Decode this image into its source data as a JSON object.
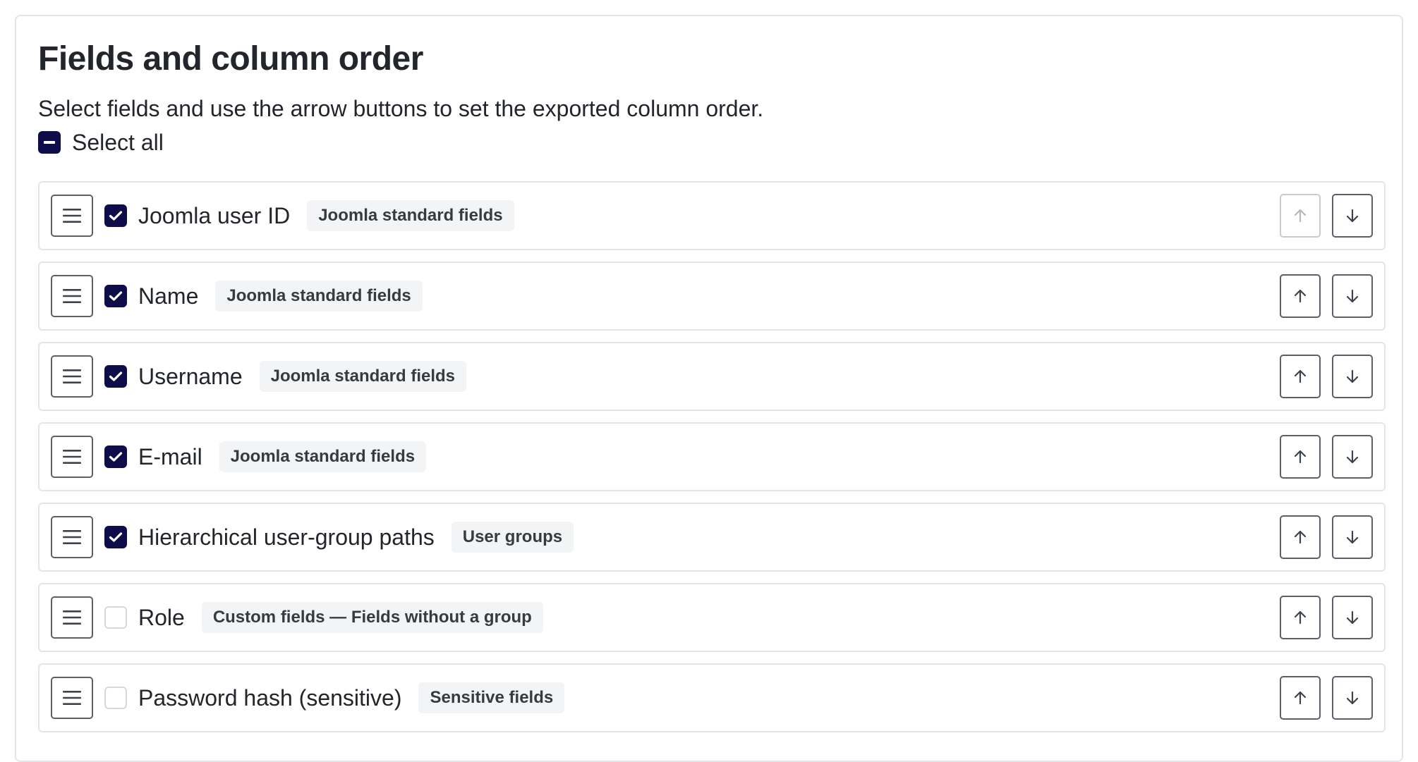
{
  "section": {
    "title": "Fields and column order",
    "description": "Select fields and use the arrow buttons to set the exported column order.",
    "select_all_label": "Select all",
    "select_all_state": "indeterminate"
  },
  "icons": {
    "drag": "drag-handle-icon",
    "check": "checkmark-icon",
    "indeterminate": "minus-icon",
    "up": "arrow-up-icon",
    "down": "arrow-down-icon"
  },
  "colors": {
    "checkbox_checked": "#0e0d4a",
    "checkbox_unchecked_border": "#d6d8dc",
    "badge_bg": "#f3f4f6",
    "row_border": "#e3e5e8",
    "button_border": "#5a6068",
    "button_disabled_border": "#c8ccd1"
  },
  "fields": [
    {
      "label": "Joomla user ID",
      "group": "Joomla standard fields",
      "checked": true,
      "up_disabled": true,
      "down_disabled": false
    },
    {
      "label": "Name",
      "group": "Joomla standard fields",
      "checked": true,
      "up_disabled": false,
      "down_disabled": false
    },
    {
      "label": "Username",
      "group": "Joomla standard fields",
      "checked": true,
      "up_disabled": false,
      "down_disabled": false
    },
    {
      "label": "E-mail",
      "group": "Joomla standard fields",
      "checked": true,
      "up_disabled": false,
      "down_disabled": false
    },
    {
      "label": "Hierarchical user-group paths",
      "group": "User groups",
      "checked": true,
      "up_disabled": false,
      "down_disabled": false
    },
    {
      "label": "Role",
      "group": "Custom fields — Fields without a group",
      "checked": false,
      "up_disabled": false,
      "down_disabled": false
    },
    {
      "label": "Password hash (sensitive)",
      "group": "Sensitive fields",
      "checked": false,
      "up_disabled": false,
      "down_disabled": false
    }
  ]
}
